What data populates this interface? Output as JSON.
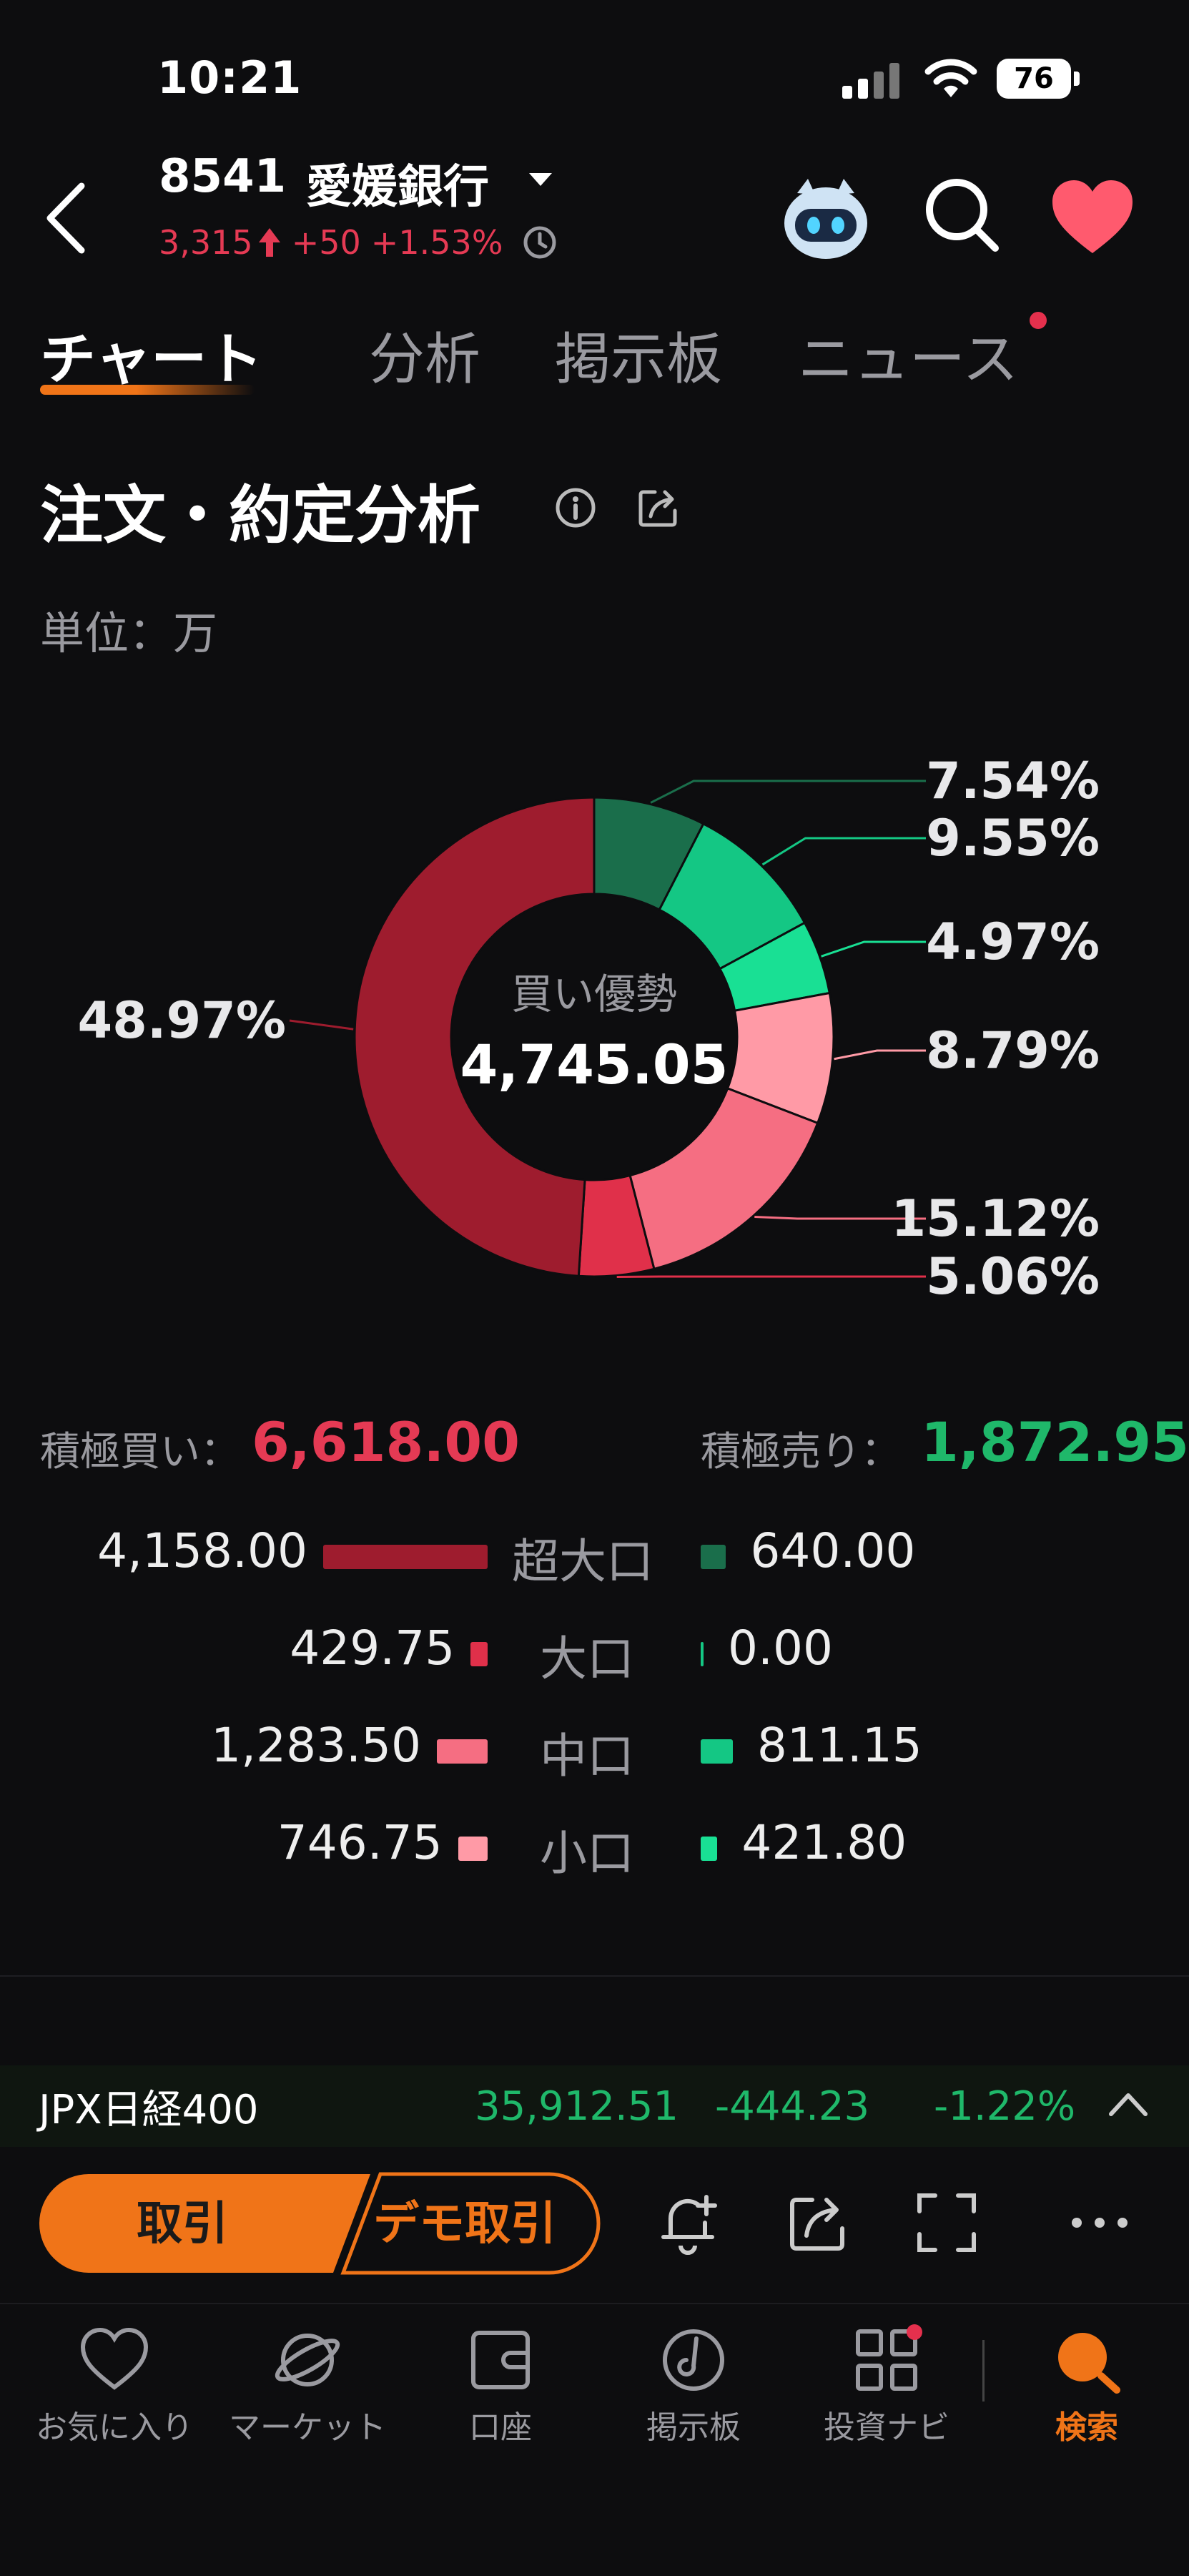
{
  "status_bar": {
    "time": "10:21",
    "battery": "76"
  },
  "header": {
    "code": "8541",
    "name": "愛媛銀行",
    "price": "3,315",
    "change": "+50",
    "change_pct": "+1.53%"
  },
  "tabs": [
    {
      "label": "チャート",
      "active": true
    },
    {
      "label": "分析",
      "active": false
    },
    {
      "label": "掲示板",
      "active": false
    },
    {
      "label": "ニュース",
      "active": false
    }
  ],
  "section": {
    "title": "注文・約定分析",
    "unit": "単位：万"
  },
  "chart_data": {
    "type": "pie",
    "center_label": "買い優勢",
    "center_value": "4,745.05",
    "slices": [
      {
        "value": 7.54,
        "label": "7.54%",
        "color": "#1a6e4b"
      },
      {
        "value": 9.55,
        "label": "9.55%",
        "color": "#14c784"
      },
      {
        "value": 4.97,
        "label": "4.97%",
        "color": "#19e094"
      },
      {
        "value": 8.79,
        "label": "8.79%",
        "color": "#ff9aa6"
      },
      {
        "value": 15.12,
        "label": "15.12%",
        "color": "#f56e82"
      },
      {
        "value": 5.06,
        "label": "5.06%",
        "color": "#e0304a"
      },
      {
        "value": 48.97,
        "label": "48.97%",
        "color": "#9e1c2e"
      }
    ]
  },
  "summary": {
    "buy_label": "積極買い：",
    "buy_value": "6,618.00",
    "sell_label": "積極売り：",
    "sell_value": "1,872.95"
  },
  "rows": [
    {
      "category": "超大口",
      "buy": "4,158.00",
      "sell": "640.00",
      "buy_color": "#9e1c2e",
      "sell_color": "#1a6e4b",
      "buy_amount": 4158.0,
      "sell_amount": 640.0
    },
    {
      "category": "大口",
      "buy": "429.75",
      "sell": "0.00",
      "buy_color": "#e0304a",
      "sell_color": "#14c784",
      "buy_amount": 429.75,
      "sell_amount": 0.0
    },
    {
      "category": "中口",
      "buy": "1,283.50",
      "sell": "811.15",
      "buy_color": "#f56e82",
      "sell_color": "#14c784",
      "buy_amount": 1283.5,
      "sell_amount": 811.15
    },
    {
      "category": "小口",
      "buy": "746.75",
      "sell": "421.80",
      "buy_color": "#ff9aa6",
      "sell_color": "#19e094",
      "buy_amount": 746.75,
      "sell_amount": 421.8
    }
  ],
  "ticker": {
    "name": "JPX日経400",
    "value": "35,912.51",
    "change": "-444.23",
    "change_pct": "-1.22%"
  },
  "actions": {
    "trade": "取引",
    "demo": "デモ取引"
  },
  "nav": [
    {
      "label": "お気に入り",
      "active": false
    },
    {
      "label": "マーケット",
      "active": false
    },
    {
      "label": "口座",
      "active": false
    },
    {
      "label": "掲示板",
      "active": false
    },
    {
      "label": "投資ナビ",
      "active": false
    },
    {
      "label": "検索",
      "active": true
    }
  ],
  "colors": {
    "accent": "#f07418",
    "up": "#e53a54",
    "down": "#1fb86a"
  }
}
